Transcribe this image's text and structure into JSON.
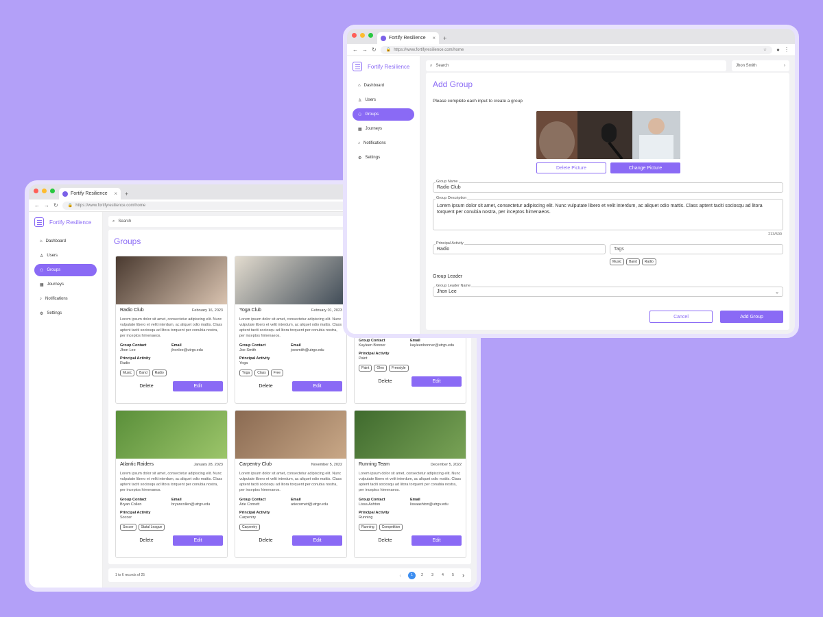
{
  "browser": {
    "tab_title": "Fortify Resilience",
    "url": "https://www.fortifyresilience.com/home"
  },
  "app": {
    "brand": "Fortify Resilience"
  },
  "sidebar": {
    "items": [
      {
        "label": "Dashboard",
        "icon": "home-icon"
      },
      {
        "label": "Users",
        "icon": "user-icon"
      },
      {
        "label": "Groups",
        "icon": "groups-icon"
      },
      {
        "label": "Journeys",
        "icon": "grid-icon"
      },
      {
        "label": "Notifications",
        "icon": "bell-icon"
      },
      {
        "label": "Settings",
        "icon": "gear-icon"
      }
    ]
  },
  "search": {
    "placeholder": "Search"
  },
  "user_menu": {
    "name": "Jhon Smith"
  },
  "groups_page": {
    "title": "Groups",
    "labels": {
      "contact": "Group Contact",
      "email": "Email",
      "activity": "Principal Activity",
      "delete": "Delete",
      "edit": "Edit"
    },
    "cards": [
      {
        "name": "Radio Club",
        "date": "February 16, 2023",
        "contact": "Jhon Lee",
        "email": "jhonlee@utrgv.edu",
        "activity": "Radio",
        "tags": [
          "Music",
          "Band",
          "Radio"
        ]
      },
      {
        "name": "Yoga Club",
        "date": "February 01, 2023",
        "contact": "Joe Smith",
        "email": "joesmith@utrgv.edu",
        "activity": "Yoga",
        "tags": [
          "Yoga",
          "Class",
          "Free"
        ]
      },
      {
        "name": "",
        "date": "",
        "contact": "Kayleen Bonner",
        "email": "kayleenbonner@utrgv.edu",
        "activity": "Paint",
        "tags": [
          "Paint",
          "Oleo",
          "Freestyle"
        ]
      },
      {
        "name": "Atlantic Raiders",
        "date": "January 28, 2023",
        "contact": "Bryan Collen",
        "email": "bryancollen@utrgv.edu",
        "activity": "Soccer",
        "tags": [
          "Soccer",
          "Statal League"
        ]
      },
      {
        "name": "Carpentry Club",
        "date": "November 5, 2022",
        "contact": "Arie Cornett",
        "email": "ariecornett@utrgv.edu",
        "activity": "Carpentry",
        "tags": [
          "Carpentry"
        ]
      },
      {
        "name": "Running Team",
        "date": "December 5, 2022",
        "contact": "Lissa Ashton",
        "email": "lissaashton@utrgv.edu",
        "activity": "Running",
        "tags": [
          "Running",
          "Competition"
        ]
      }
    ],
    "description": "Lorem ipsum dolor sit amet, consectetur adipiscing elit. Nunc vulputate libero et velit interdum, ac aliquet odio mattis. Class aptent taciti sociosqu ad litora torquent per conubia nostra, per inceptos himenaeos.",
    "pagination": {
      "summary": "1 to 6 records of 25",
      "pages": [
        "1",
        "2",
        "3",
        "4",
        "5"
      ],
      "current": "1"
    }
  },
  "add_group": {
    "title": "Add Group",
    "subtitle": "Please complete each input to create a group",
    "delete_picture": "Delete Picture",
    "change_picture": "Change Picture",
    "group_name_label": "Group Name",
    "group_name_value": "Radio Club",
    "description_label": "Group Description",
    "description_value": "Lorem ipsum dolor sit amet, consectetur adipiscing elit. Nunc vulputate libero et velit interdum, ac aliquet odio mattis. Class aptent taciti sociosqu ad litora torquent per conubia nostra, per inceptos himenaeos.",
    "char_count": "213/500",
    "activity_label": "Principal Activity",
    "activity_value": "Radio",
    "tags_placeholder": "Tags",
    "tags": [
      "Music",
      "Band",
      "Radio"
    ],
    "leader_section": "Group Leader",
    "leader_label": "Group Leader Name",
    "leader_value": "Jhon Lee",
    "cancel": "Cancel",
    "submit": "Add Group"
  },
  "colors": {
    "accent": "#8a6af5",
    "background": "#b3a0f8",
    "page_current": "#3d8ef0"
  }
}
